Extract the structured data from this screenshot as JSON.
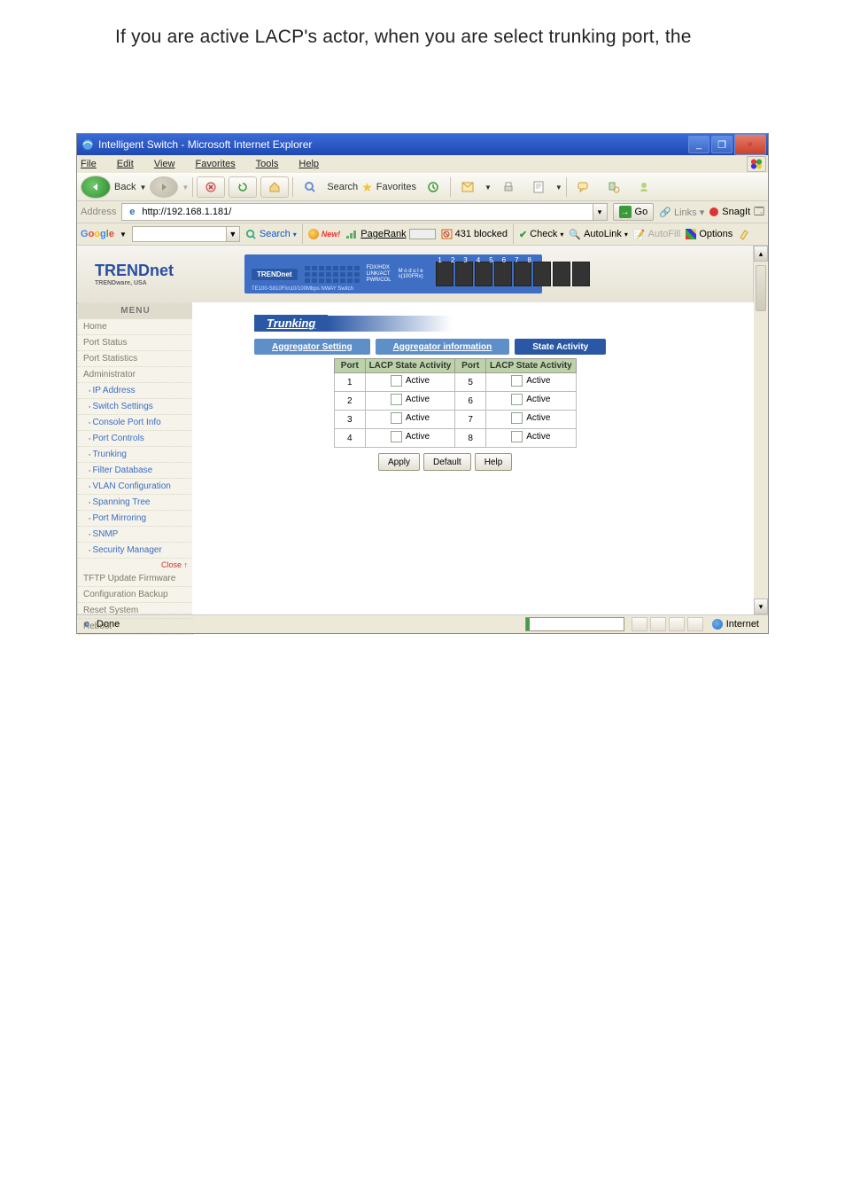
{
  "intro_text": "If you are active LACP's actor, when you are select trunking port, the",
  "window": {
    "title": "Intelligent Switch - Microsoft Internet Explorer",
    "min": "_",
    "max": "❐",
    "close": "✕"
  },
  "menubar": {
    "file": "File",
    "edit": "Edit",
    "view": "View",
    "favorites": "Favorites",
    "tools": "Tools",
    "help": "Help"
  },
  "ietb": {
    "back": "Back",
    "search": "Search",
    "favorites": "Favorites"
  },
  "addr": {
    "label": "Address",
    "url": "http://192.168.1.181/",
    "go": "Go",
    "links": "Links",
    "snag": "SnagIt"
  },
  "google": {
    "logo": {
      "g1": "G",
      "o1": "o",
      "o2": "o",
      "g2": "g",
      "l": "l",
      "e": "e"
    },
    "tbsep": "▼",
    "search": "Search",
    "new": "New!",
    "pagerank": "PageRank",
    "blocked": "431 blocked",
    "check": "Check",
    "autolink": "AutoLink",
    "autofill": "AutoFill",
    "options": "Options"
  },
  "banner": {
    "brand": "TRENDnet",
    "brand_sub": "TRENDware, USA",
    "panel_brand": "TRENDnet",
    "panel_line2": "FDX ■",
    "panel_line3": "TE100-S810Fi\\n10/100Mbps NWAY Switch",
    "col_labels": [
      "FDX/HDX",
      "LINK/ACT",
      "PWR/COL"
    ],
    "right": "M o d u l e s(100FRx)",
    "port_nums": [
      "1",
      "2",
      "3",
      "4",
      "5",
      "6",
      "7",
      "8"
    ]
  },
  "menu_header": "MENU",
  "nav": {
    "home": "Home",
    "port_status": "Port Status",
    "port_stats": "Port Statistics",
    "admin": "Administrator",
    "ip": "IP Address",
    "switch": "Switch Settings",
    "console": "Console Port Info",
    "controls": "Port Controls",
    "trunking": "Trunking",
    "filterdb": "Filter Database",
    "vlan": "VLAN Configuration",
    "spanning": "Spanning Tree",
    "mirror": "Port Mirroring",
    "snmp": "SNMP",
    "security": "Security Manager",
    "close": "Close ↑",
    "tftp": "TFTP Update Firmware",
    "cfgb": "Configuration Backup",
    "reset": "Reset System",
    "reboot": "Reboot"
  },
  "main": {
    "title": "Trunking",
    "tabs": {
      "agg_set": "Aggregator Setting",
      "agg_info": "Aggregator information",
      "state": "State Activity"
    },
    "th": {
      "port": "Port",
      "lacp": "LACP State Activity",
      "port2": "Port",
      "lacp2": "LACP State Activity"
    },
    "rows": [
      {
        "pL": "1",
        "aL": "Active",
        "pR": "5",
        "aR": "Active"
      },
      {
        "pL": "2",
        "aL": "Active",
        "pR": "6",
        "aR": "Active"
      },
      {
        "pL": "3",
        "aL": "Active",
        "pR": "7",
        "aR": "Active"
      },
      {
        "pL": "4",
        "aL": "Active",
        "pR": "8",
        "aR": "Active"
      }
    ],
    "btn_apply": "Apply",
    "btn_default": "Default",
    "btn_help": "Help"
  },
  "status": {
    "done": "Done",
    "progress_value": "4",
    "internet": "Internet"
  }
}
